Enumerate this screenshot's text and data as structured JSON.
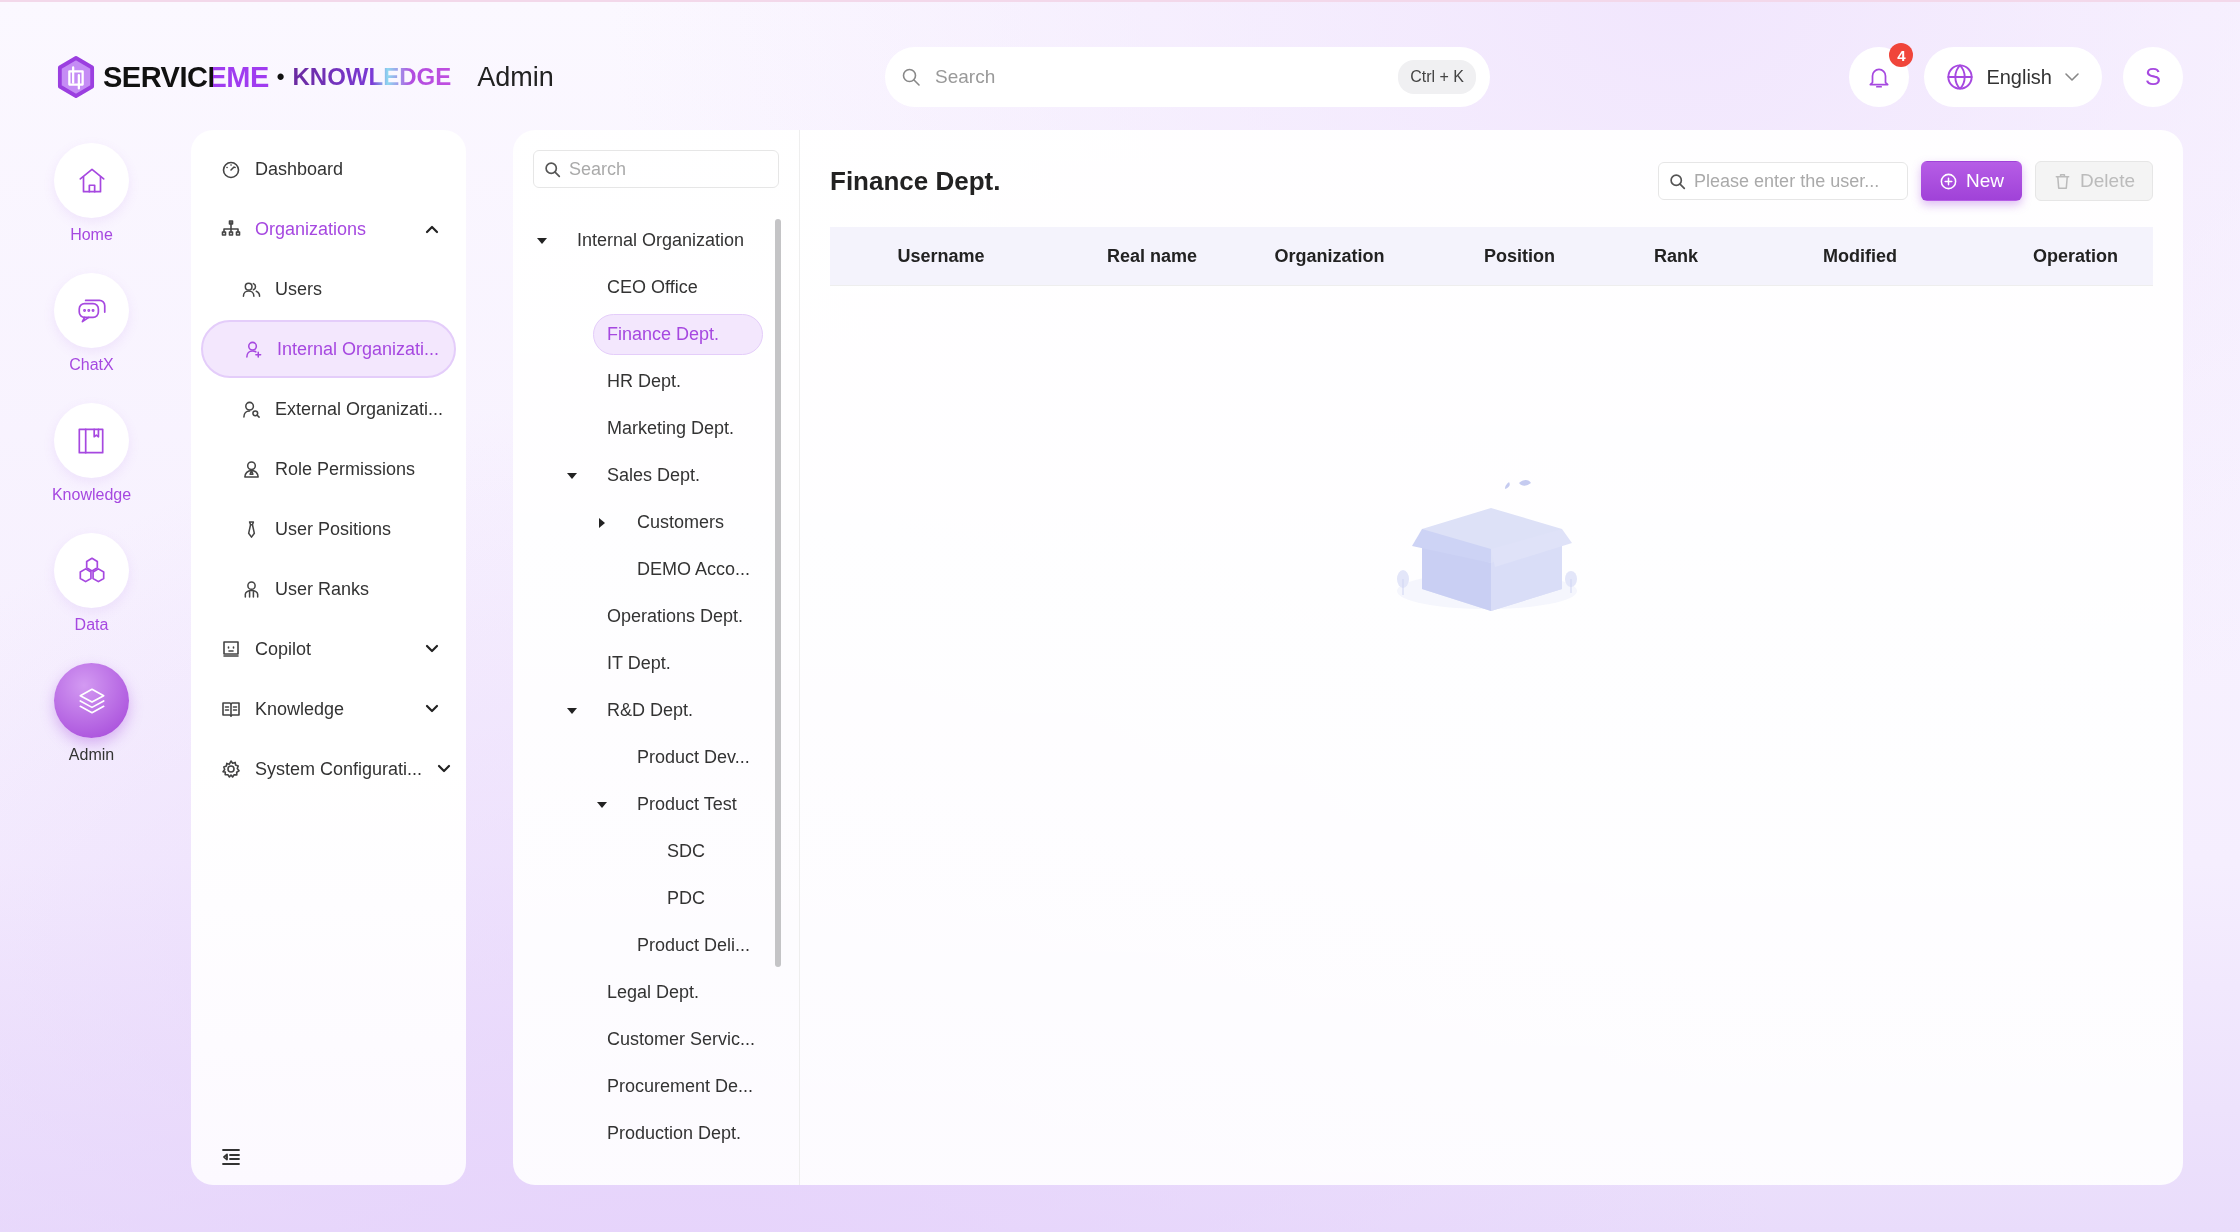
{
  "header": {
    "logo": {
      "name": "SERVICEME",
      "separator": "•",
      "product": "KNOWLEDGE"
    },
    "section": "Admin",
    "search": {
      "placeholder": "Search",
      "shortcut": "Ctrl + K"
    },
    "notifications": {
      "count": "4"
    },
    "language": "English",
    "avatar": "S"
  },
  "rail": [
    {
      "label": "Home",
      "selected": false
    },
    {
      "label": "ChatX",
      "selected": false
    },
    {
      "label": "Knowledge",
      "selected": false
    },
    {
      "label": "Data",
      "selected": false
    },
    {
      "label": "Admin",
      "selected": true
    }
  ],
  "sidebar": {
    "items": [
      {
        "kind": "item",
        "label": "Dashboard",
        "selected": false
      },
      {
        "kind": "group",
        "label": "Organizations",
        "expanded": true,
        "children": [
          {
            "label": "Users",
            "selected": false
          },
          {
            "label": "Internal Organizati...",
            "selected": true
          },
          {
            "label": "External Organizati...",
            "selected": false
          },
          {
            "label": "Role Permissions",
            "selected": false
          },
          {
            "label": "User Positions",
            "selected": false
          },
          {
            "label": "User Ranks",
            "selected": false
          }
        ]
      },
      {
        "kind": "group",
        "label": "Copilot",
        "expanded": false
      },
      {
        "kind": "group",
        "label": "Knowledge",
        "expanded": false
      },
      {
        "kind": "group",
        "label": "System Configurati...",
        "expanded": false
      }
    ]
  },
  "tree": {
    "search": {
      "placeholder": "Search"
    },
    "nodes": [
      {
        "kind": "branch",
        "label": "Internal Organization",
        "expanded": true,
        "selected": false,
        "children": [
          {
            "kind": "leaf",
            "label": "CEO Office",
            "selected": false
          },
          {
            "kind": "leaf",
            "label": "Finance Dept.",
            "selected": true
          },
          {
            "kind": "leaf",
            "label": "HR Dept.",
            "selected": false
          },
          {
            "kind": "leaf",
            "label": "Marketing Dept.",
            "selected": false
          },
          {
            "kind": "branch",
            "label": "Sales Dept.",
            "expanded": true,
            "selected": false,
            "children": [
              {
                "kind": "branch",
                "label": "Customers",
                "expanded": false,
                "selected": false
              },
              {
                "kind": "leaf",
                "label": "DEMO Acco...",
                "selected": false
              }
            ]
          },
          {
            "kind": "leaf",
            "label": "Operations Dept.",
            "selected": false
          },
          {
            "kind": "leaf",
            "label": "IT Dept.",
            "selected": false
          },
          {
            "kind": "branch",
            "label": "R&D Dept.",
            "expanded": true,
            "selected": false,
            "children": [
              {
                "kind": "leaf",
                "label": "Product Dev...",
                "selected": false
              },
              {
                "kind": "branch",
                "label": "Product Test",
                "expanded": true,
                "selected": false,
                "children": [
                  {
                    "kind": "leaf",
                    "label": "SDC",
                    "selected": false
                  },
                  {
                    "kind": "leaf",
                    "label": "PDC",
                    "selected": false
                  }
                ]
              },
              {
                "kind": "leaf",
                "label": "Product Deli...",
                "selected": false
              }
            ]
          },
          {
            "kind": "leaf",
            "label": "Legal Dept.",
            "selected": false
          },
          {
            "kind": "leaf",
            "label": "Customer Servic...",
            "selected": false
          },
          {
            "kind": "leaf",
            "label": "Procurement De...",
            "selected": false
          },
          {
            "kind": "leaf",
            "label": "Production Dept.",
            "selected": false
          }
        ]
      }
    ]
  },
  "panel": {
    "title": "Finance Dept.",
    "search": {
      "placeholder": "Please enter the user..."
    },
    "buttons": [
      {
        "label": "New",
        "disabled": false
      },
      {
        "label": "Delete",
        "disabled": true
      }
    ],
    "table": {
      "columns": [
        "Username",
        "Real name",
        "Organization",
        "Position",
        "Rank",
        "Modified",
        "Operation"
      ]
    }
  }
}
